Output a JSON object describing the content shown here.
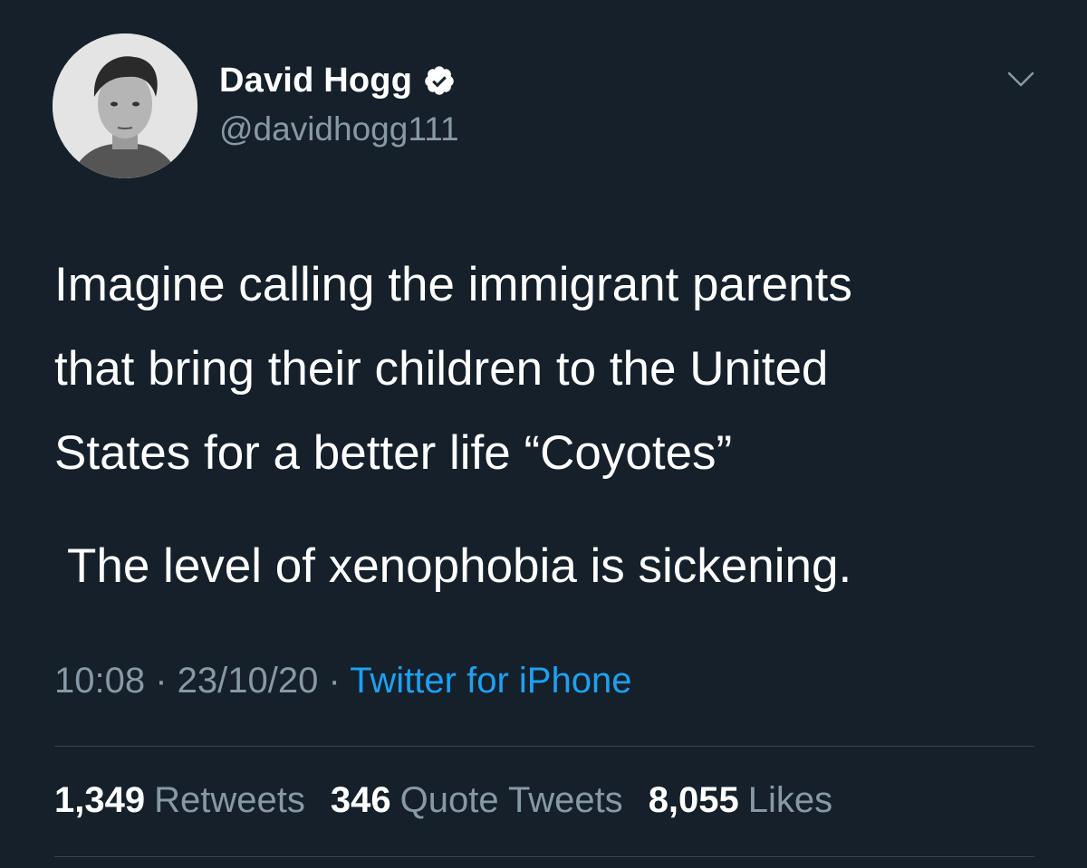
{
  "author": {
    "display_name": "David Hogg",
    "handle": "@davidhogg111",
    "verified_icon": "verified-badge-icon",
    "avatar_icon": "profile-photo"
  },
  "menu_icon": "chevron-down-icon",
  "tweet": {
    "lines_para1": [
      "Imagine calling the immigrant parents",
      "that bring their children to the United",
      "States for a better life “Coyotes”"
    ],
    "para2": "The level of xenophobia is sickening."
  },
  "meta": {
    "time": "10:08",
    "sep1": " · ",
    "date": "23/10/20",
    "sep2": " · ",
    "source": "Twitter for iPhone"
  },
  "stats": {
    "retweets_count": "1,349",
    "retweets_label": "Retweets",
    "quotes_count": "346",
    "quotes_label": "Quote Tweets",
    "likes_count": "8,055",
    "likes_label": "Likes"
  },
  "colors": {
    "background": "#15202b",
    "secondary_text": "#8899a6",
    "link": "#1da1f2",
    "divider": "#38444d"
  }
}
